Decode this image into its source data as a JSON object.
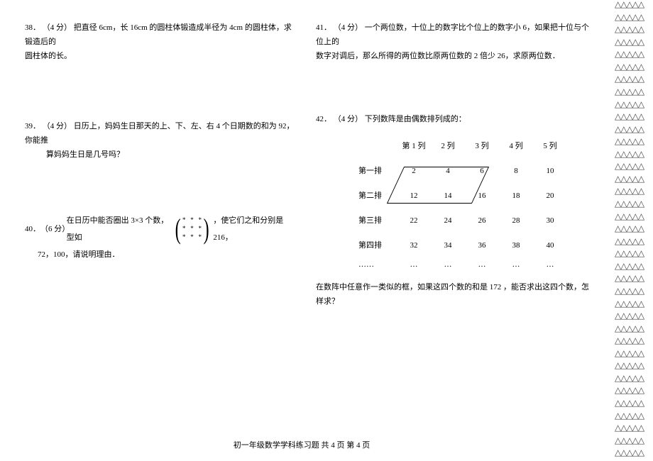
{
  "questions": {
    "q38": {
      "num": "38．",
      "points": "（4 分）",
      "text_a": "把直径 6cm，长 16cm 的圆柱体锻造成半径为 4cm 的圆柱体，求锻造后的",
      "text_b": "圆柱体的长。"
    },
    "q39": {
      "num": "39．",
      "points": "（4 分）",
      "text_a": "日历上，妈妈生日那天的上、下、左、右 4 个日期数的和为 92，你能推",
      "text_b": "算妈妈生日是几号吗？"
    },
    "q40": {
      "num": "40．",
      "points": "（6 分）",
      "text_a": "在日历中能否圈出 3×3 个数，型如",
      "text_b": "，使它们之和分别是 216，",
      "text_c": "72，100，请说明理由．",
      "matrix_row": "*   *   *"
    },
    "q41": {
      "num": "41．",
      "points": "（4 分）",
      "text_a": "一个两位数，十位上的数字比个位上的数字小 6，如果把十位与个位上的",
      "text_b": "数字对调后，那么所得的两位数比原两位数的 2 倍少 26，求原两位数．"
    },
    "q42": {
      "num": "42．",
      "points": "（4 分）",
      "text_a": "下列数阵是由偶数排列成的：",
      "text_b": "在数阵中任意作一类似的框，如果这四个数的和是 172 ，能否求出这四个数，怎样求？",
      "col_headers": [
        "第 1 列",
        "2 列",
        "3 列",
        "4 列",
        "5 列"
      ],
      "row_headers": [
        "第一排",
        "第二排",
        "第三排",
        "第四排",
        "……"
      ],
      "rows": [
        [
          "2",
          "4",
          "6",
          "8",
          "10"
        ],
        [
          "12",
          "14",
          "16",
          "18",
          "20"
        ],
        [
          "22",
          "24",
          "26",
          "28",
          "30"
        ],
        [
          "32",
          "34",
          "36",
          "38",
          "40"
        ],
        [
          "…",
          "…",
          "…",
          "…",
          "…"
        ]
      ]
    }
  },
  "footer": "初一年级数学学科练习题   共 4 页   第  4 页",
  "deco_char": "△△△△△"
}
